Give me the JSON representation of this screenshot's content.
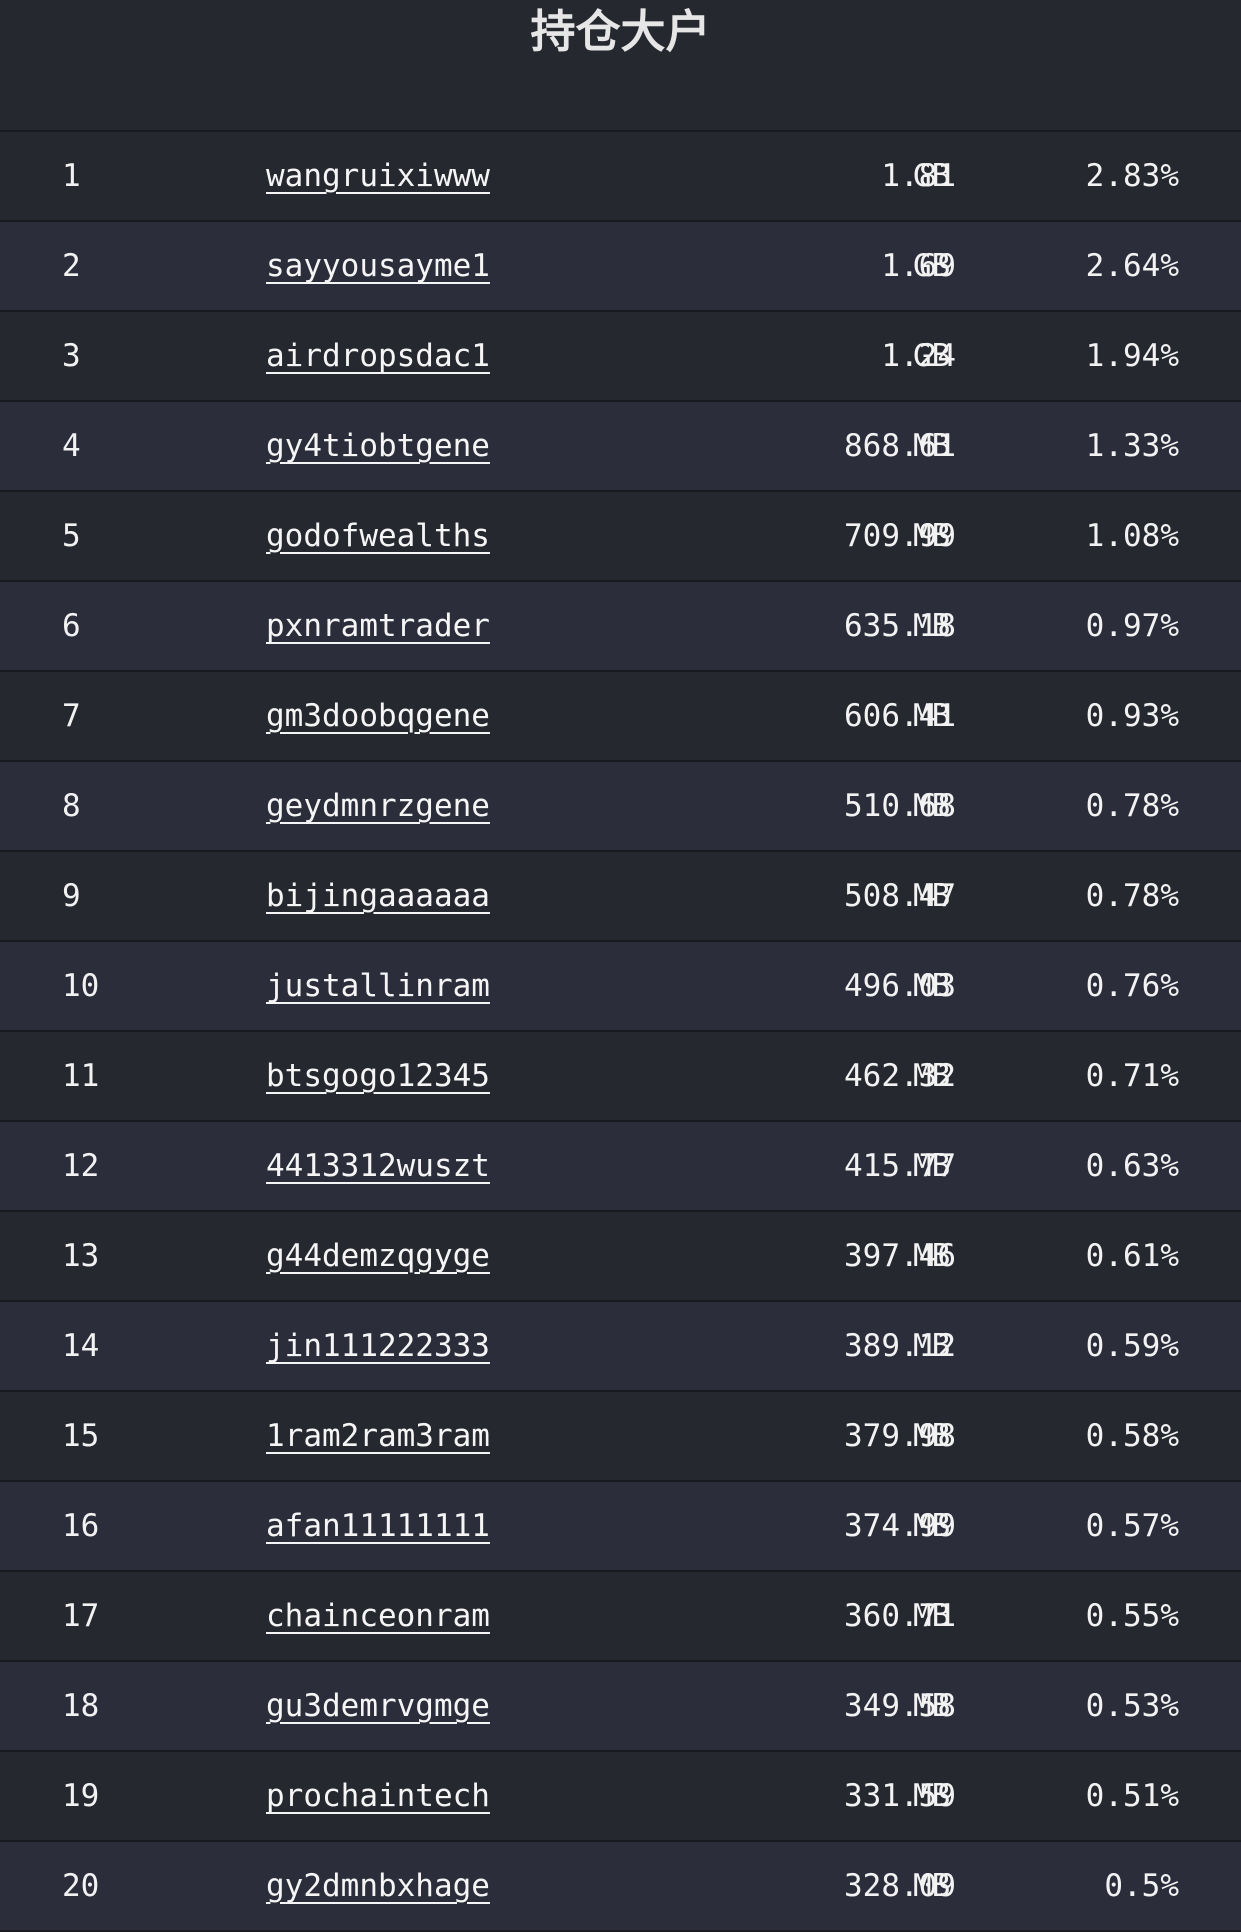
{
  "title": "持仓大户",
  "rows": [
    {
      "rank": "1",
      "account": "wangruixiwww",
      "amount": "1.81",
      "unit": "GB",
      "percent": "2.83%"
    },
    {
      "rank": "2",
      "account": "sayyousayme1",
      "amount": "1.69",
      "unit": "GB",
      "percent": "2.64%"
    },
    {
      "rank": "3",
      "account": "airdropsdac1",
      "amount": "1.24",
      "unit": "GB",
      "percent": "1.94%"
    },
    {
      "rank": "4",
      "account": "gy4tiobtgene",
      "amount": "868.61",
      "unit": "MB",
      "percent": "1.33%"
    },
    {
      "rank": "5",
      "account": "godofwealths",
      "amount": "709.99",
      "unit": "MB",
      "percent": "1.08%"
    },
    {
      "rank": "6",
      "account": "pxnramtrader",
      "amount": "635.18",
      "unit": "MB",
      "percent": "0.97%"
    },
    {
      "rank": "7",
      "account": "gm3doobqgene",
      "amount": "606.41",
      "unit": "MB",
      "percent": "0.93%"
    },
    {
      "rank": "8",
      "account": "geydmnrzgene",
      "amount": "510.68",
      "unit": "MB",
      "percent": "0.78%"
    },
    {
      "rank": "9",
      "account": "bijingaaaaaa",
      "amount": "508.47",
      "unit": "MB",
      "percent": "0.78%"
    },
    {
      "rank": "10",
      "account": "justallinram",
      "amount": "496.03",
      "unit": "MB",
      "percent": "0.76%"
    },
    {
      "rank": "11",
      "account": "btsgogo12345",
      "amount": "462.32",
      "unit": "MB",
      "percent": "0.71%"
    },
    {
      "rank": "12",
      "account": "4413312wuszt",
      "amount": "415.77",
      "unit": "MB",
      "percent": "0.63%"
    },
    {
      "rank": "13",
      "account": "g44demzqgyge",
      "amount": "397.46",
      "unit": "MB",
      "percent": "0.61%"
    },
    {
      "rank": "14",
      "account": "jin111222333",
      "amount": "389.12",
      "unit": "MB",
      "percent": "0.59%"
    },
    {
      "rank": "15",
      "account": "1ram2ram3ram",
      "amount": "379.98",
      "unit": "MB",
      "percent": "0.58%"
    },
    {
      "rank": "16",
      "account": "afan11111111",
      "amount": "374.99",
      "unit": "MB",
      "percent": "0.57%"
    },
    {
      "rank": "17",
      "account": "chainceonram",
      "amount": "360.71",
      "unit": "MB",
      "percent": "0.55%"
    },
    {
      "rank": "18",
      "account": "gu3demrvgmge",
      "amount": "349.58",
      "unit": "MB",
      "percent": "0.53%"
    },
    {
      "rank": "19",
      "account": "prochaintech",
      "amount": "331.59",
      "unit": "MB",
      "percent": "0.51%"
    },
    {
      "rank": "20",
      "account": "gy2dmnbxhage",
      "amount": "328.09",
      "unit": "MB",
      "percent": "0.5%"
    }
  ]
}
